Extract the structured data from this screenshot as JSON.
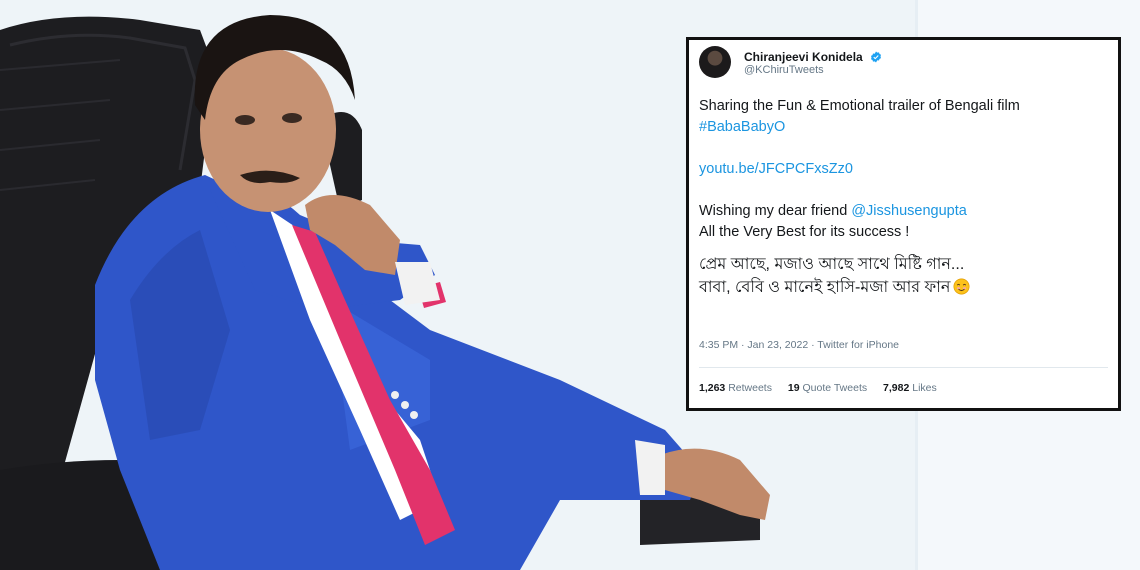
{
  "tweet": {
    "display_name": "Chiranjeevi Konidela",
    "handle": "@KChiruTweets",
    "verified_icon": "verified-badge-icon",
    "lines": {
      "l1": "Sharing the Fun & Emotional trailer of Bengali film",
      "hashtag": "#BabaBabyO",
      "link": "youtu.be/JFCPCFxsZz0",
      "wish_prefix": "Wishing my dear friend ",
      "mention": "@Jisshusengupta",
      "best": "All the Very Best for its success !",
      "bengali_1": "প্রেম আছে, মজাও আছে সাথে মিষ্টি গান...",
      "bengali_2": "বাবা, বেবি ও মানেই হাসি-মজা আর ফান"
    },
    "emoji": "smiling-face-icon",
    "timestamp": "4:35 PM · Jan 23, 2022 · Twitter for iPhone",
    "stats": {
      "retweets_count": "1,263",
      "retweets_label": "Retweets",
      "quotes_count": "19",
      "quotes_label": "Quote Tweets",
      "likes_count": "7,982",
      "likes_label": "Likes"
    }
  },
  "colors": {
    "link": "#1b95e0",
    "suit": "#2f56c9",
    "tie": "#e2336b",
    "background": "#eef4f8"
  }
}
